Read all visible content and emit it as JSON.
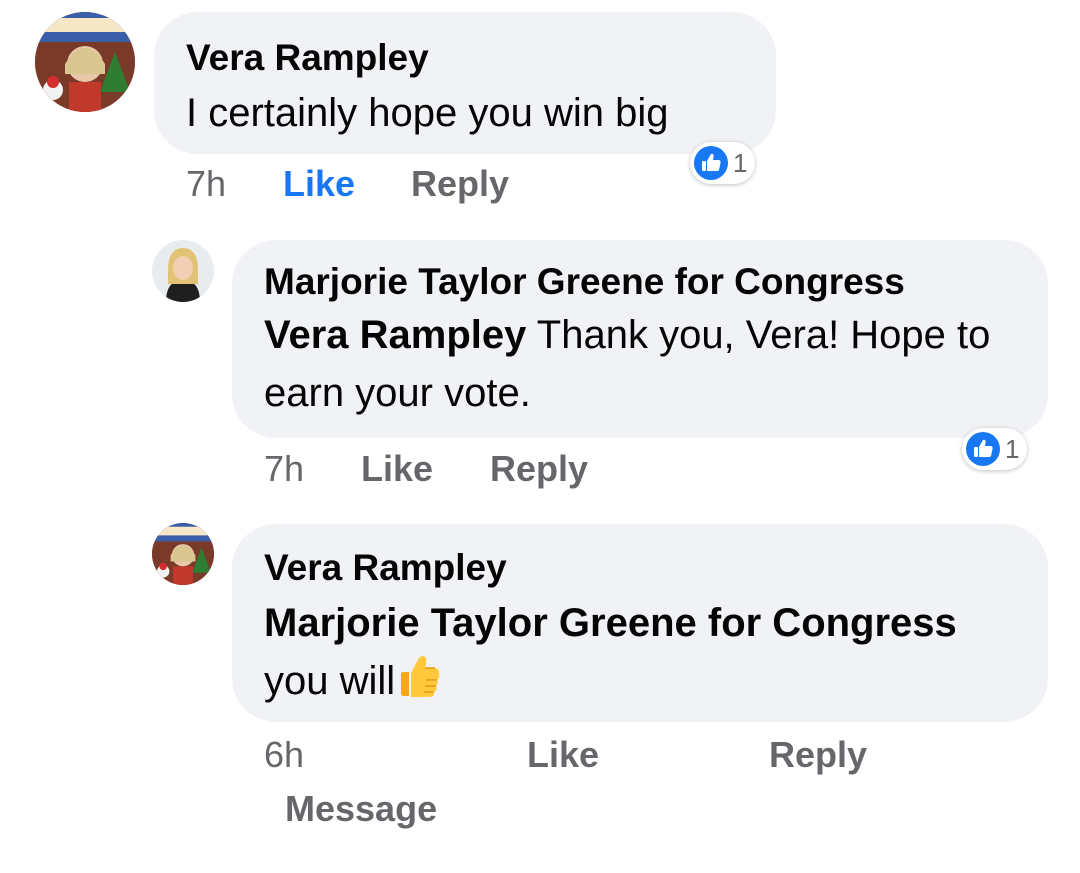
{
  "colors": {
    "bubble_bg": "#f0f2f5",
    "action_gray": "#65676b",
    "like_blue": "#1877f2",
    "text": "#050505"
  },
  "comments": [
    {
      "author": "Vera Rampley",
      "avatar_icon": "christmas-photo-avatar",
      "text": "I certainly hope you win big",
      "time": "7h",
      "like_label": "Like",
      "like_active": true,
      "reply_label": "Reply",
      "reaction_icon": "like-reaction-icon",
      "reaction_count": "1"
    },
    {
      "author": "Marjorie Taylor Greene for Congress",
      "avatar_icon": "woman-portrait-avatar",
      "mention": "Vera Rampley",
      "text": " Thank you, Vera! Hope to earn your vote.",
      "time": "7h",
      "like_label": "Like",
      "like_active": false,
      "reply_label": "Reply",
      "reaction_icon": "like-reaction-icon",
      "reaction_count": "1"
    },
    {
      "author": "Vera Rampley",
      "avatar_icon": "christmas-photo-avatar",
      "mention": "Marjorie Taylor Greene for Congress",
      "text": "you will",
      "emoji": "thumbs-up-emoji",
      "time": "6h",
      "like_label": "Like",
      "like_active": false,
      "reply_label": "Reply",
      "message_label": "Message"
    }
  ]
}
